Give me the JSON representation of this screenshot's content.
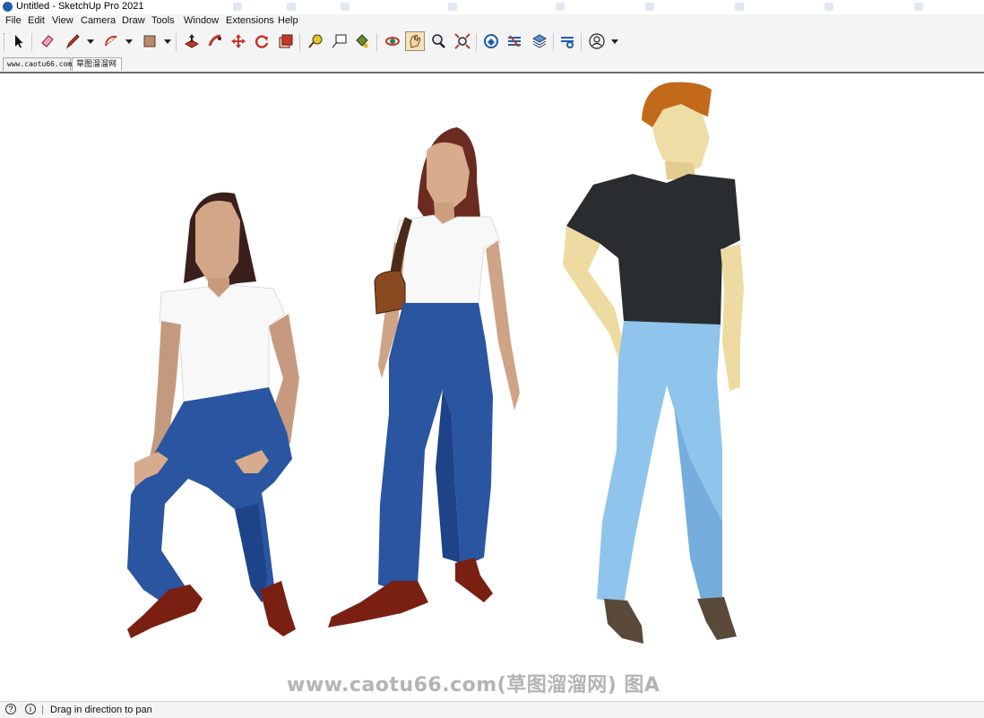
{
  "window": {
    "title": "Untitled - SketchUp Pro 2021"
  },
  "menu": [
    "File",
    "Edit",
    "View",
    "Camera",
    "Draw",
    "Tools",
    "Window",
    "Extensions",
    "Help"
  ],
  "toolbar": {
    "tools": [
      {
        "name": "select-icon"
      },
      {
        "name": "eraser-icon"
      },
      {
        "name": "pencil-line-icon"
      },
      {
        "name": "arc-icon"
      },
      {
        "name": "rectangle-icon"
      },
      {
        "name": "push-pull-icon"
      },
      {
        "name": "follow-me-icon"
      },
      {
        "name": "move-icon"
      },
      {
        "name": "rotate-icon"
      },
      {
        "name": "scale-icon"
      },
      {
        "name": "tape-measure-icon"
      },
      {
        "name": "text-icon"
      },
      {
        "name": "paint-bucket-icon"
      },
      {
        "name": "orbit-icon"
      },
      {
        "name": "pan-icon"
      },
      {
        "name": "zoom-icon"
      },
      {
        "name": "zoom-extents-icon"
      },
      {
        "name": "warehouse-icon"
      },
      {
        "name": "extension-warehouse-icon"
      },
      {
        "name": "layer-icon"
      },
      {
        "name": "extension-manager-icon"
      },
      {
        "name": "account-icon"
      }
    ],
    "active_tool": "pan-icon"
  },
  "tabs": [
    {
      "label": "www.caotu66.com",
      "selected": false
    },
    {
      "label": "草图溜溜网",
      "selected": true
    }
  ],
  "viewport": {
    "watermark": "www.caotu66.com(草图溜溜网) 图A"
  },
  "status": {
    "message": "Drag in direction to pan"
  },
  "colors": {
    "accent": "#1f5ea8",
    "shirt_dark": "#2a2d2f",
    "jeans": "#2a55a0",
    "light_jeans": "#8fc4ec",
    "skin": "#d8a988"
  }
}
